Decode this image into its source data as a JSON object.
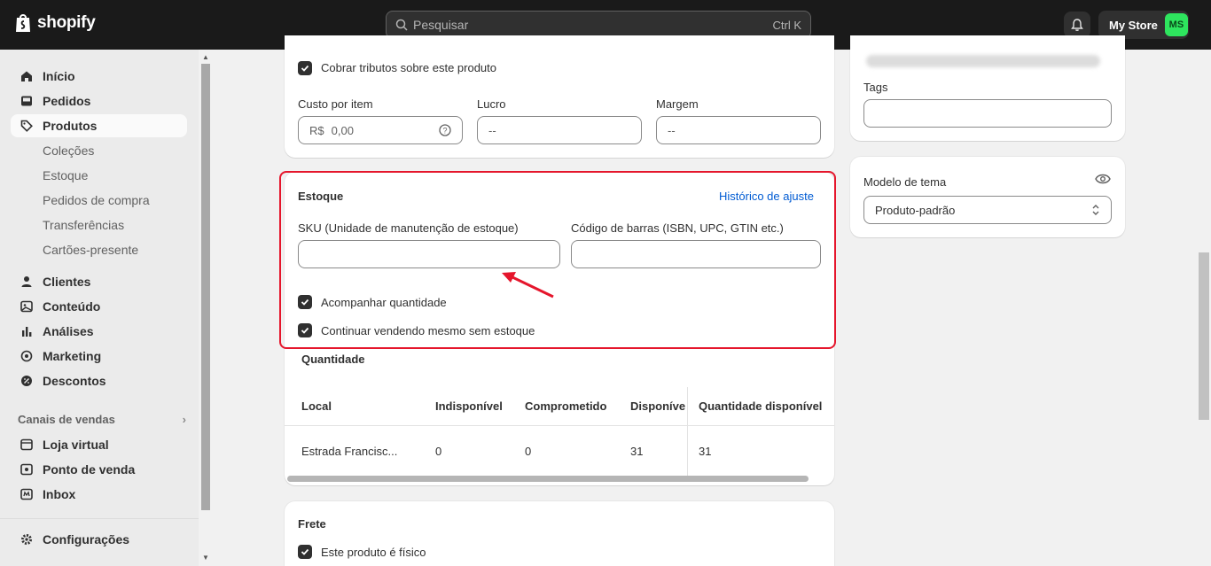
{
  "topbar": {
    "brand": "shopify",
    "search_placeholder": "Pesquisar",
    "search_shortcut": "Ctrl K",
    "store_name": "My Store",
    "avatar_initials": "MS",
    "avatar_color": "#2ee55e"
  },
  "sidebar": {
    "items": [
      {
        "label": "Início",
        "icon": "home-icon"
      },
      {
        "label": "Pedidos",
        "icon": "inbox-icon"
      },
      {
        "label": "Produtos",
        "icon": "tag-icon",
        "active": true
      },
      {
        "label": "Clientes",
        "icon": "person-icon"
      },
      {
        "label": "Conteúdo",
        "icon": "image-icon"
      },
      {
        "label": "Análises",
        "icon": "bar-chart-icon"
      },
      {
        "label": "Marketing",
        "icon": "target-icon"
      },
      {
        "label": "Descontos",
        "icon": "discount-icon"
      }
    ],
    "product_subitems": [
      "Coleções",
      "Estoque",
      "Pedidos de compra",
      "Transferências",
      "Cartões-presente"
    ],
    "sales_channels_title": "Canais de vendas",
    "sales_channels": [
      {
        "label": "Loja virtual",
        "icon": "store-icon"
      },
      {
        "label": "Ponto de venda",
        "icon": "pos-icon"
      },
      {
        "label": "Inbox",
        "icon": "chat-icon"
      }
    ],
    "settings_label": "Configurações"
  },
  "pricing": {
    "charge_tax_label": "Cobrar tributos sobre este produto",
    "cost_label": "Custo por item",
    "cost_prefix": "R$",
    "cost_value": "0,00",
    "profit_label": "Lucro",
    "profit_value": "--",
    "margin_label": "Margem",
    "margin_value": "--"
  },
  "inventory": {
    "title": "Estoque",
    "history_link": "Histórico de ajuste",
    "sku_label": "SKU (Unidade de manutenção de estoque)",
    "sku_value": "",
    "barcode_label": "Código de barras (ISBN, UPC, GTIN etc.)",
    "barcode_value": "",
    "track_quantity_label": "Acompanhar quantidade",
    "continue_selling_label": "Continuar vendendo mesmo sem estoque",
    "quantity_title": "Quantidade",
    "columns": [
      "Local",
      "Indisponível",
      "Comprometido",
      "Disponível",
      "Quantidade disponível"
    ],
    "rows": [
      {
        "local": "Estrada Francisc...",
        "unavailable": "0",
        "committed": "0",
        "available": "31",
        "on_hand": "31"
      }
    ]
  },
  "shipping": {
    "title": "Frete",
    "physical_label": "Este produto é físico"
  },
  "organization": {
    "tags_label": "Tags",
    "tags_value": ""
  },
  "theme": {
    "title": "Modelo de tema",
    "selected": "Produto-padrão"
  },
  "colors": {
    "highlight": "#e5162c",
    "link": "#005bd3",
    "topbar": "#1a1a1a"
  }
}
